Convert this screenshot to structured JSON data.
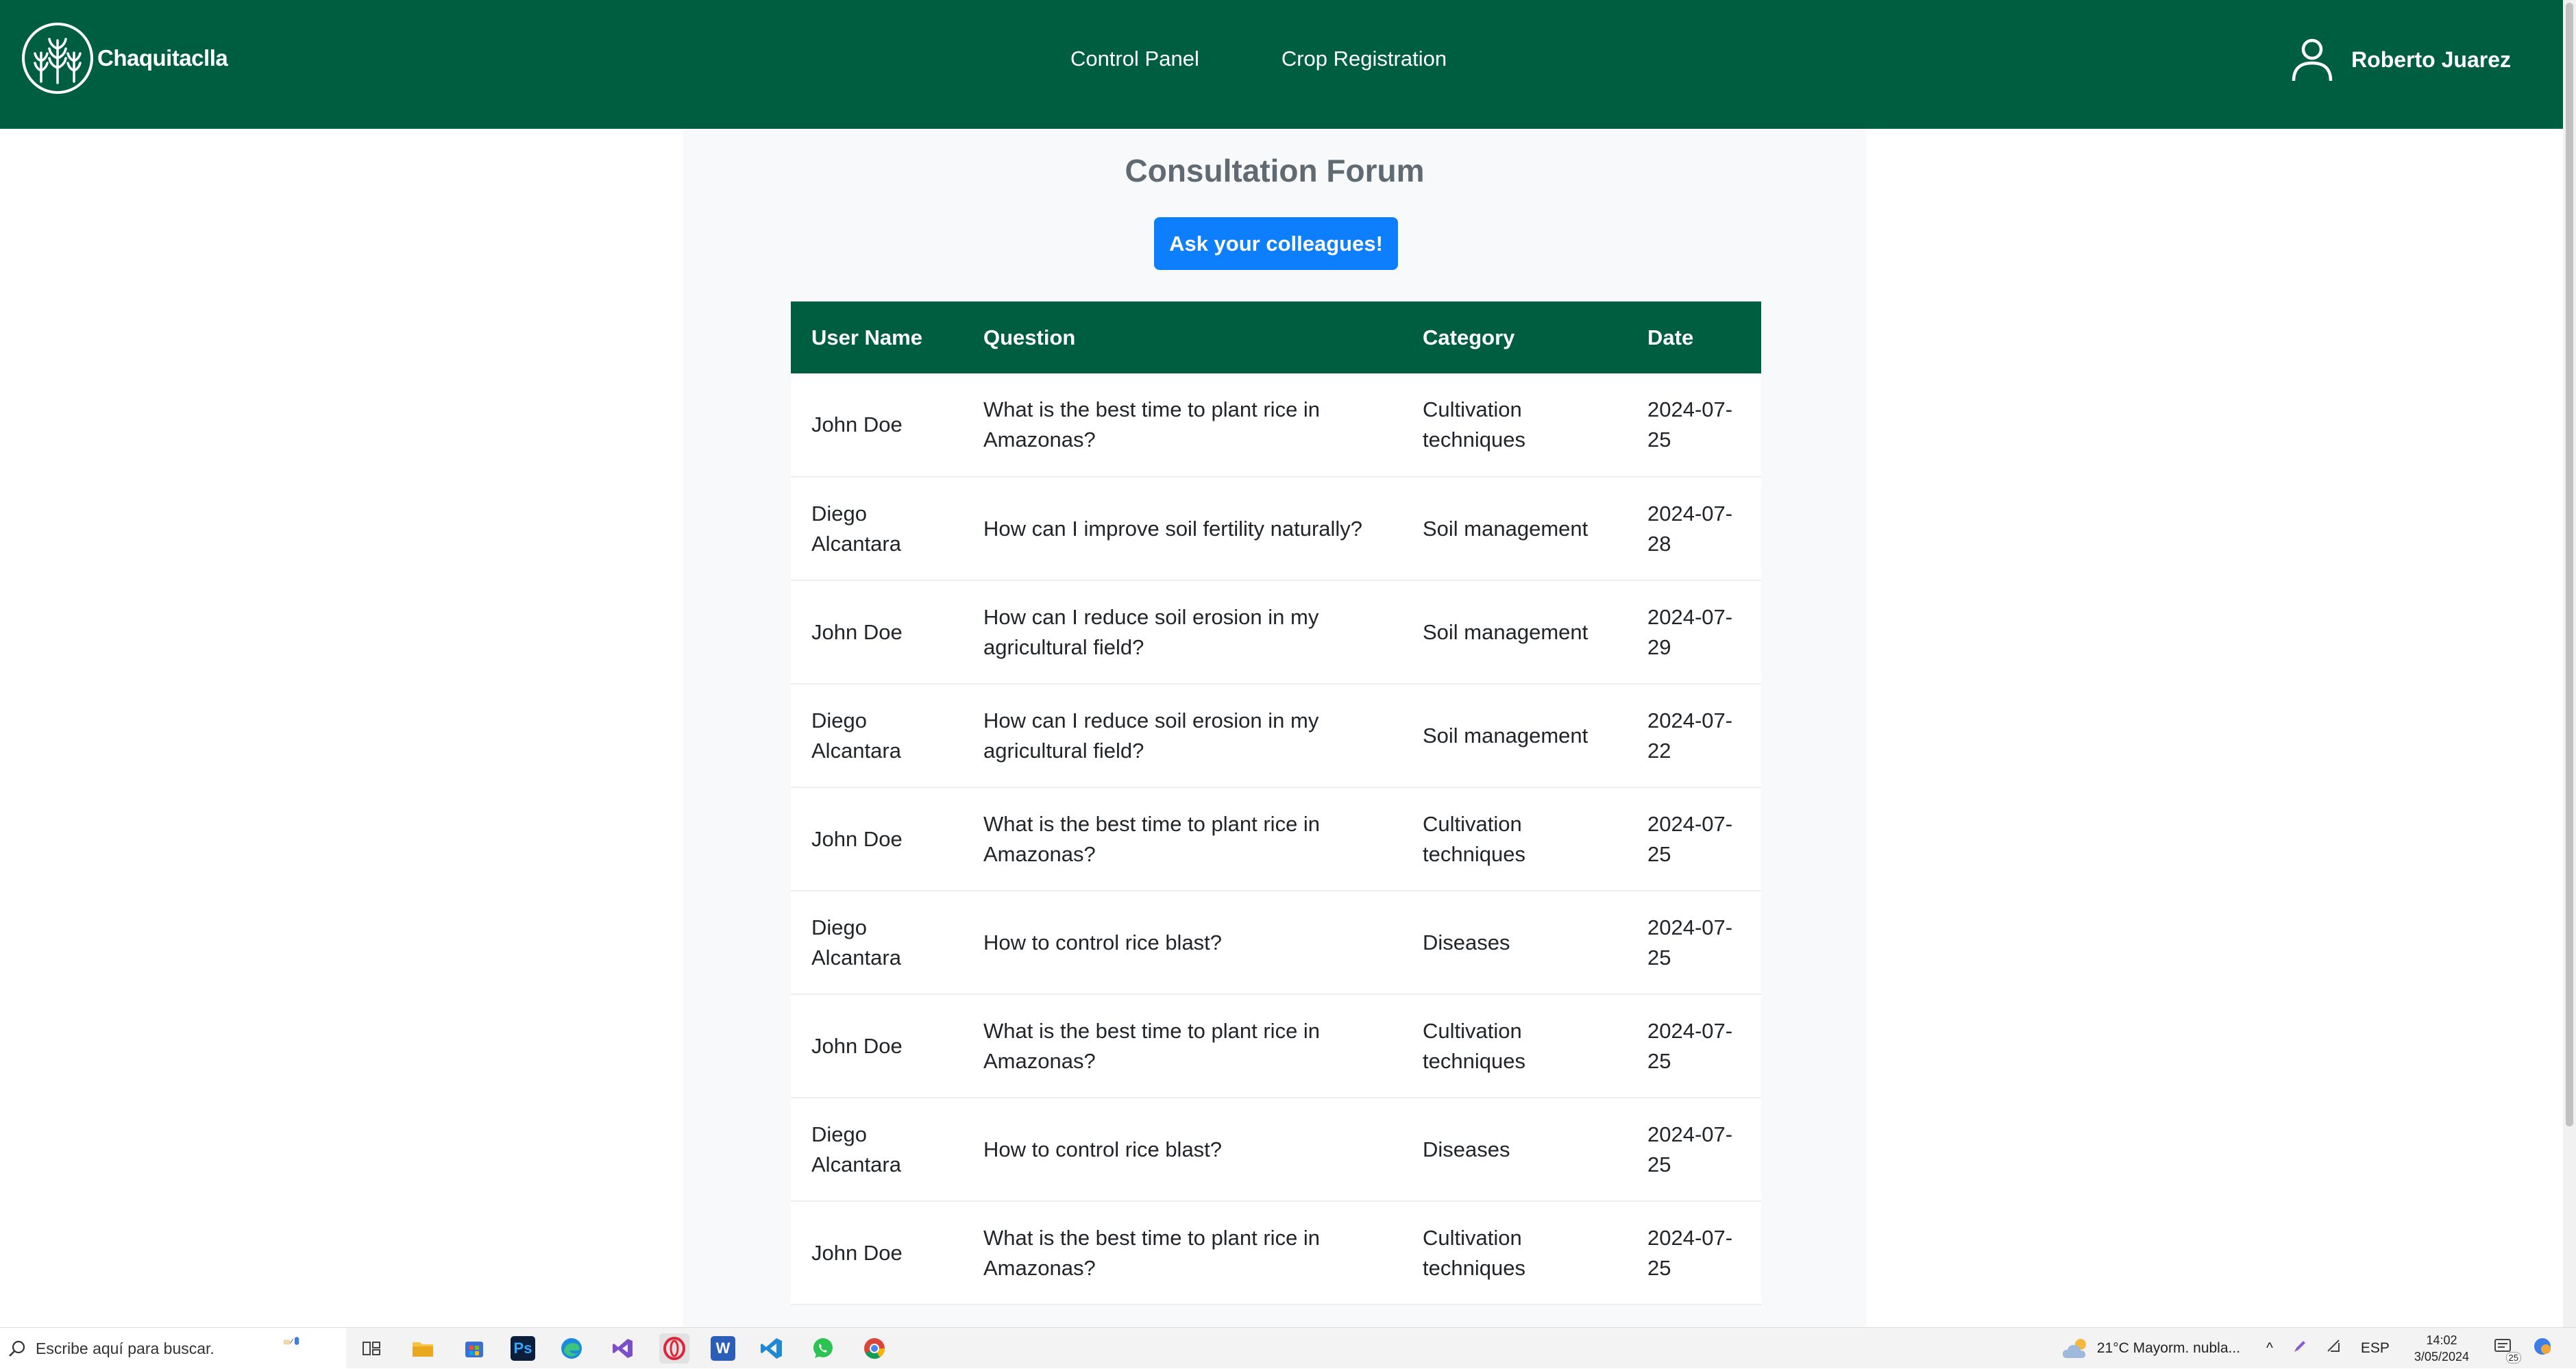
{
  "brand": {
    "name": "Chaquitaclla"
  },
  "nav": {
    "links": [
      "Control Panel",
      "Crop Registration"
    ],
    "user_name": "Roberto Juarez"
  },
  "forum": {
    "title": "Consultation Forum",
    "ask_button": "Ask your colleagues!",
    "columns": [
      "User Name",
      "Question",
      "Category",
      "Date"
    ],
    "rows": [
      {
        "user": "John Doe",
        "question": "What is the best time to plant rice in Amazonas?",
        "category": "Cultivation techniques",
        "date": "2024-07-25"
      },
      {
        "user": "Diego Alcantara",
        "question": "How can I improve soil fertility naturally?",
        "category": "Soil management",
        "date": "2024-07-28"
      },
      {
        "user": "John Doe",
        "question": "How can I reduce soil erosion in my agricultural field?",
        "category": "Soil management",
        "date": "2024-07-29"
      },
      {
        "user": "Diego Alcantara",
        "question": "How can I reduce soil erosion in my agricultural field?",
        "category": "Soil management",
        "date": "2024-07-22"
      },
      {
        "user": "John Doe",
        "question": "What is the best time to plant rice in Amazonas?",
        "category": "Cultivation techniques",
        "date": "2024-07-25"
      },
      {
        "user": "Diego Alcantara",
        "question": "How to control rice blast?",
        "category": "Diseases",
        "date": "2024-07-25"
      },
      {
        "user": "John Doe",
        "question": "What is the best time to plant rice in Amazonas?",
        "category": "Cultivation techniques",
        "date": "2024-07-25"
      },
      {
        "user": "Diego Alcantara",
        "question": "How to control rice blast?",
        "category": "Diseases",
        "date": "2024-07-25"
      },
      {
        "user": "John Doe",
        "question": "What is the best time to plant rice in Amazonas?",
        "category": "Cultivation techniques",
        "date": "2024-07-25"
      }
    ]
  },
  "taskbar": {
    "search_placeholder": "Escribe aquí para buscar.",
    "apps": [
      "file-explorer-icon",
      "store-icon",
      "photoshop-icon",
      "edge-icon",
      "visual-studio-icon",
      "opera-icon",
      "word-icon",
      "vscode-icon",
      "whatsapp-icon",
      "chrome-icon"
    ],
    "app_labels": {
      "photoshop": "Ps",
      "word": "W"
    },
    "weather": "21°C  Mayorm. nubla...",
    "language": "ESP",
    "time": "14:02",
    "date": "3/05/2024",
    "notification_count": "25"
  },
  "colors": {
    "primary_green": "#005e40",
    "button_blue": "#0d7efc",
    "title_gray": "#5f6a72"
  }
}
